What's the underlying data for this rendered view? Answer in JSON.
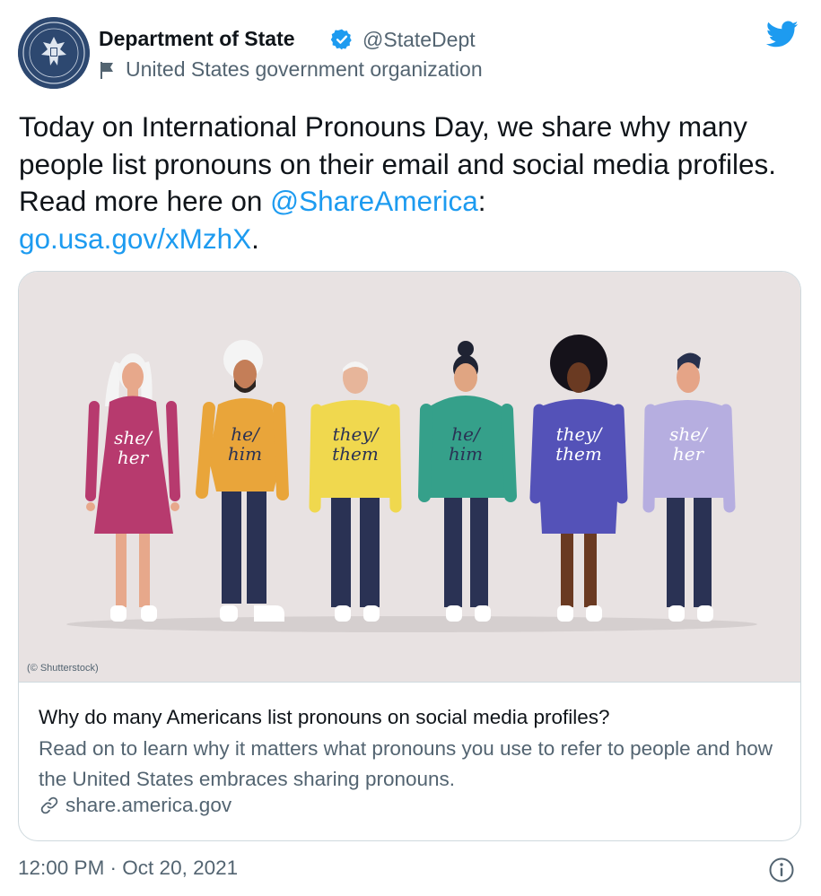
{
  "account": {
    "name": "Department of State",
    "handle": "@StateDept",
    "org_label": "United States government organization"
  },
  "tweet": {
    "text_parts": {
      "part1": "Today on International Pronouns Day, we share why many people list pronouns on their email and social media profiles. Read more here on ",
      "mention": "@ShareAmerica",
      "part2": ":",
      "url": "go.usa.gov/xMzhX",
      "part3": "."
    },
    "timestamp": "12:00 PM · Oct 20, 2021"
  },
  "card": {
    "image_credit": "(© Shutterstock)",
    "figures": [
      {
        "line1": "she/",
        "line2": "her"
      },
      {
        "line1": "he/",
        "line2": "him"
      },
      {
        "line1": "they/",
        "line2": "them"
      },
      {
        "line1": "he/",
        "line2": "him"
      },
      {
        "line1": "they/",
        "line2": "them"
      },
      {
        "line1": "she/",
        "line2": "her"
      }
    ],
    "title": "Why do many Americans list pronouns on social media profiles?",
    "description": "Read on to learn why it matters what pronouns you use to refer to people and how the United States embraces sharing pronouns.",
    "domain": "share.america.gov"
  },
  "colors": {
    "link": "#1d9bf0",
    "verified": "#1d9bf0",
    "secondary_text": "#536471"
  },
  "icons": [
    "seal-avatar",
    "verified-badge-icon",
    "flag-icon",
    "twitter-bird-icon",
    "link-icon",
    "info-icon"
  ]
}
